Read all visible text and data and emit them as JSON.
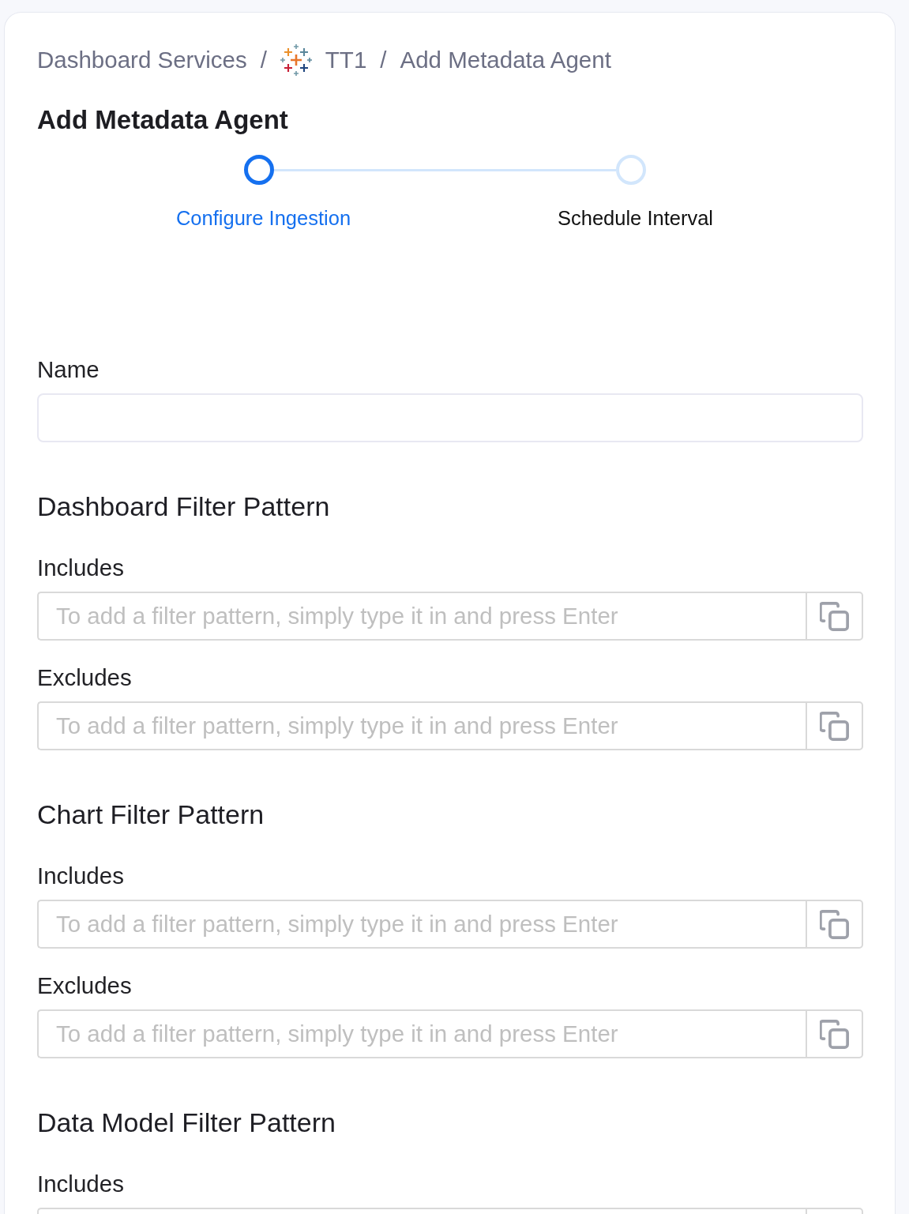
{
  "breadcrumb": [
    {
      "kind": "link",
      "label": "Dashboard Services"
    },
    {
      "kind": "separator",
      "label": "/"
    },
    {
      "kind": "service",
      "label": "TT1"
    },
    {
      "kind": "separator",
      "label": "/"
    },
    {
      "kind": "current",
      "label": "Add Metadata Agent"
    }
  ],
  "title": "Add Metadata Agent",
  "steps": [
    {
      "label": "Configure Ingestion",
      "selected": true
    },
    {
      "label": "Schedule Interval",
      "selected": false
    }
  ],
  "name_field": {
    "label": "Name"
  },
  "sections": [
    {
      "title": "Dashboard Filter Pattern",
      "fields": [
        {
          "label": "Includes",
          "placeholder": "To add a filter pattern, simply type it in and press Enter"
        },
        {
          "label": "Excludes",
          "placeholder": "To add a filter pattern, simply type it in and press Enter"
        }
      ]
    },
    {
      "title": "Chart Filter Pattern",
      "fields": [
        {
          "label": "Includes",
          "placeholder": "To add a filter pattern, simply type it in and press Enter"
        },
        {
          "label": "Excludes",
          "placeholder": "To add a filter pattern, simply type it in and press Enter"
        }
      ]
    },
    {
      "title": "Data Model Filter Pattern",
      "fields": [
        {
          "label": "Includes"
        }
      ]
    }
  ]
}
